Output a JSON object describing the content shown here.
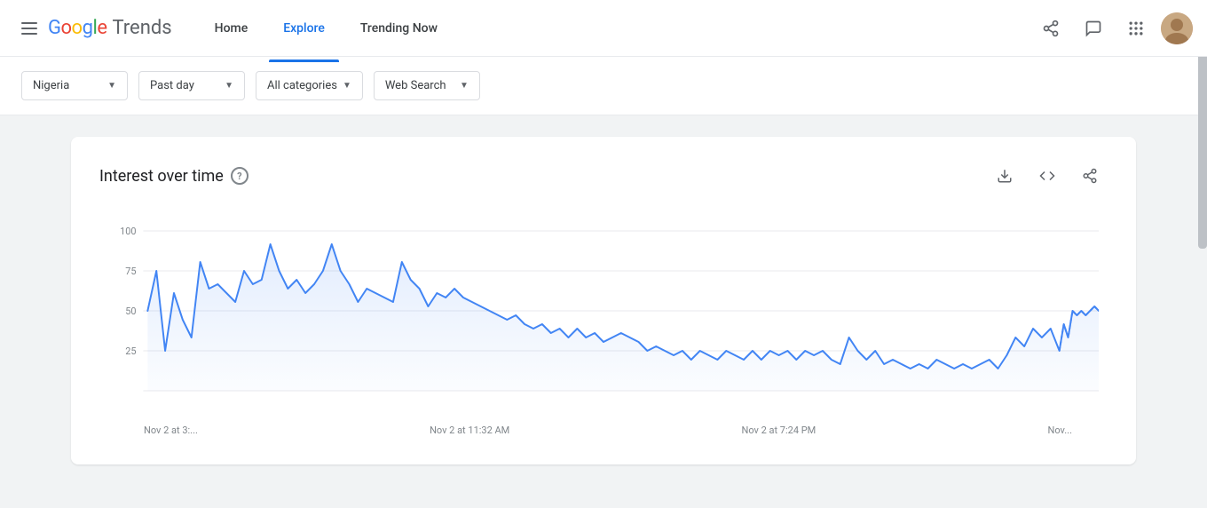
{
  "header": {
    "hamburger_label": "☰",
    "logo": {
      "google": "Google",
      "trends": "Trends"
    },
    "nav": {
      "items": [
        {
          "id": "home",
          "label": "Home",
          "active": false
        },
        {
          "id": "explore",
          "label": "Explore",
          "active": true
        },
        {
          "id": "trending_now",
          "label": "Trending Now",
          "active": false
        }
      ]
    },
    "actions": {
      "share_label": "⤴",
      "feedback_label": "💬",
      "apps_label": "⋮⋮⋮",
      "avatar_label": "A"
    }
  },
  "filters": {
    "country": {
      "label": "Nigeria",
      "value": "NG"
    },
    "time": {
      "label": "Past day",
      "value": "now 1-d"
    },
    "category": {
      "label": "All categories",
      "value": "0"
    },
    "search_type": {
      "label": "Web Search",
      "value": "0"
    }
  },
  "chart": {
    "title": "Interest over time",
    "help_tooltip": "?",
    "actions": {
      "download": "⬇",
      "embed": "<>",
      "share": "⤴"
    },
    "y_axis": [
      "100",
      "75",
      "50",
      "25"
    ],
    "x_axis": [
      "Nov 2 at 3:...",
      "Nov 2 at 11:32 AM",
      "Nov 2 at 7:24 PM",
      "Nov..."
    ],
    "line_color": "#4285f4",
    "grid_color": "#e8eaed"
  }
}
